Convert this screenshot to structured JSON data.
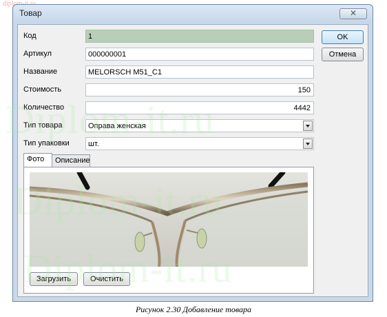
{
  "watermark": {
    "site": "diplom-it.ru",
    "big_text": [
      "Diplom-it.ru",
      "Diplom-it.ru",
      "Diplom-it.ru"
    ]
  },
  "dialog": {
    "title": "Товар",
    "close_glyph": "✕",
    "buttons": {
      "ok": "OK",
      "cancel": "Отмена"
    },
    "fields": [
      {
        "label": "Код",
        "value": "1"
      },
      {
        "label": "Артикул",
        "value": "000000001"
      },
      {
        "label": "Название",
        "value": "MELORSCH M51_C1"
      },
      {
        "label": "Стоимость",
        "value": "150"
      },
      {
        "label": "Количество",
        "value": "4442"
      },
      {
        "label": "Тип товара",
        "value": "Оправа женская"
      },
      {
        "label": "Тип упаковки",
        "value": "шт."
      }
    ],
    "tabs": [
      {
        "label": "Фото"
      },
      {
        "label": "Описание"
      }
    ],
    "photo_buttons": {
      "load": "Загрузить",
      "clear": "Очистить"
    }
  },
  "caption": "Рисунок 2.30 Добавление товара",
  "colors": {
    "frame": "#c9d9ea",
    "readonly_field": "#b8ceb8",
    "default_button": "#3c7fb1"
  }
}
